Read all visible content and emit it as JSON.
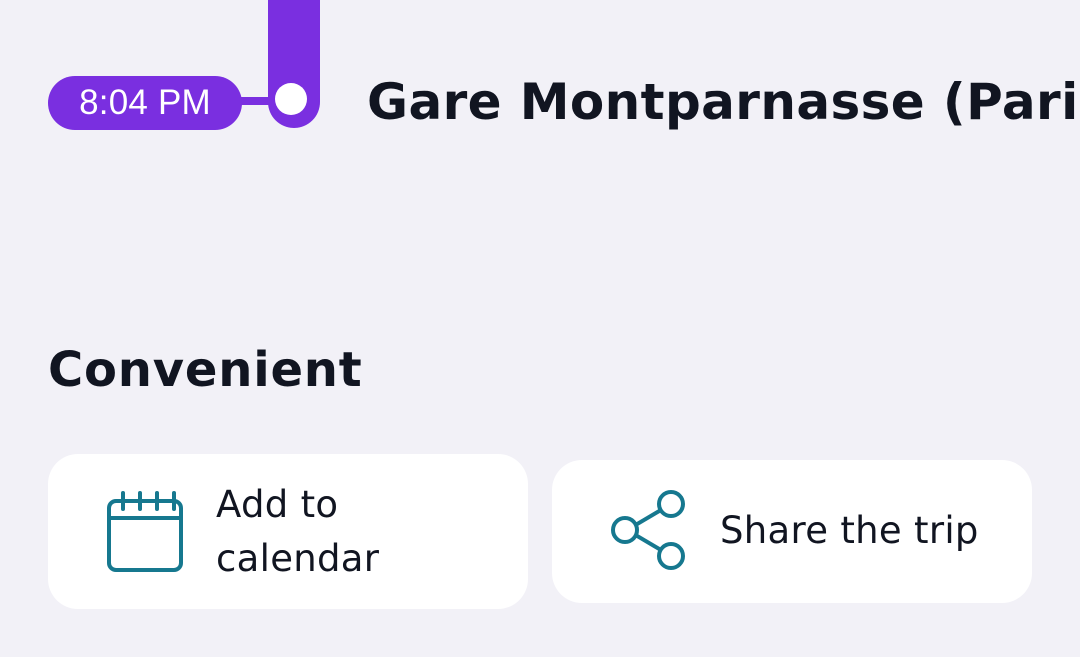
{
  "timeline": {
    "time": "8:04 PM",
    "station": "Gare Montparnasse (Paris)",
    "accent_color": "#7a2fe0"
  },
  "section": {
    "title": "Convenient"
  },
  "actions": [
    {
      "label": "Add to calendar",
      "icon": "calendar-icon"
    },
    {
      "label": "Share the trip",
      "icon": "share-icon"
    }
  ],
  "colors": {
    "background": "#f2f1f7",
    "card": "#ffffff",
    "icon": "#16788f",
    "text": "#111521"
  }
}
